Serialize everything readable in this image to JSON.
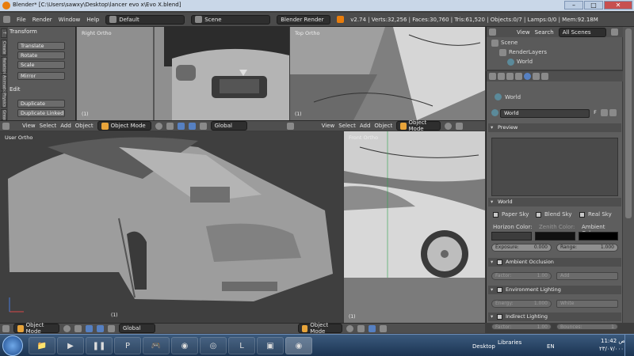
{
  "window": {
    "title": "Blender* [C:\\Users\\sawxy\\Desktop\\lancer evo x\\Evo X.blend]",
    "min": "–",
    "max": "□",
    "close": "✕"
  },
  "info_header": {
    "menus": [
      "File",
      "Render",
      "Window",
      "Help"
    ],
    "layout": "Default",
    "scene": "Scene",
    "engine": "Blender Render",
    "stats": "v2.74 | Verts:32,256 | Faces:30,760 | Tris:61,520 | Objects:0/7 | Lamps:0/0 | Mem:92.18M"
  },
  "toolshelf": {
    "tabs": [
      "T",
      "Create",
      "Relations",
      "Animation",
      "Physics",
      "Grease"
    ],
    "transform_header": "Transform",
    "transform": [
      "Translate",
      "Rotate",
      "Scale",
      "Mirror"
    ],
    "edit_header": "Edit",
    "edit": [
      "Duplicate",
      "Duplicate Linked"
    ]
  },
  "viewports": {
    "right": {
      "label": "Right Ortho",
      "frame": "(1)"
    },
    "top": {
      "label": "Top Ortho",
      "frame": "(1)"
    },
    "user": {
      "label": "User Ortho",
      "frame": "(1)"
    },
    "front": {
      "label": "Front Ortho",
      "frame": "(1)"
    }
  },
  "vp_header": {
    "menus": [
      "View",
      "Select",
      "Add",
      "Object"
    ],
    "mode": "Object Mode",
    "orientation": "Global"
  },
  "outliner": {
    "view": "View",
    "search": "Search",
    "filter": "All Scenes",
    "items": [
      "Scene",
      "RenderLayers",
      "World"
    ]
  },
  "properties": {
    "breadcrumb": "World",
    "world_name": "World",
    "f_label": "F",
    "preview": "Preview",
    "world": "World",
    "sky": [
      "Paper Sky",
      "Blend Sky",
      "Real Sky"
    ],
    "horizon_color": "Horizon Color:",
    "zenith_color": "Zenith Color:",
    "ambient_color": "Ambient Color:",
    "exposure_label": "Exposure:",
    "exposure": "0.000",
    "range_label": "Range:",
    "range": "1.000",
    "ao": "Ambient Occlusion",
    "ao_factor_label": "Factor:",
    "ao_factor": "1.00",
    "ao_blend": "Add",
    "env": "Environment Lighting",
    "env_energy_label": "Energy:",
    "env_energy": "1.000",
    "env_color": "White",
    "indirect": "Indirect Lighting",
    "ind_factor_label": "Factor:",
    "ind_factor": "1.00",
    "ind_bounces_label": "Bounces:",
    "ind_bounces": "1"
  },
  "colors": {
    "horizon": "#3c3c3c",
    "zenith": "#111111",
    "ambient": "#000000",
    "accent": "#5680c2"
  },
  "taskbar": {
    "desktop": "Desktop",
    "libraries": "Libraries",
    "lang": "EN",
    "time": "11:42 ص",
    "date": "٢٣/٠٧/٠٠٠"
  }
}
